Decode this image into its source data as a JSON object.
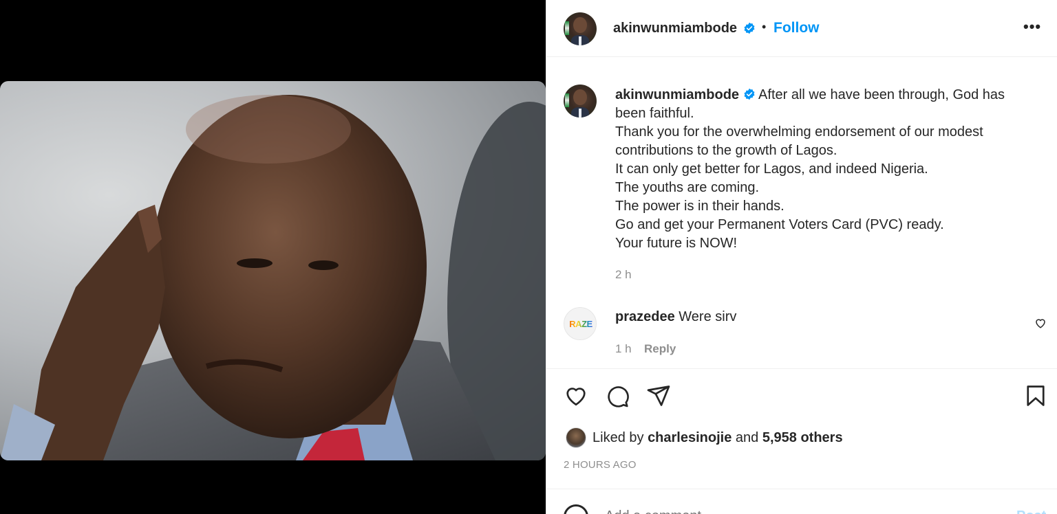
{
  "header": {
    "username": "akinwunmiambode",
    "separator": "•",
    "follow_label": "Follow",
    "more_label": "•••"
  },
  "caption": {
    "username": "akinwunmiambode",
    "first_line": "After all we have been through, God has been faithful.",
    "lines": [
      "Thank you for the overwhelming endorsement of our modest contributions to the growth of Lagos.",
      "It can only get better for Lagos, and indeed Nigeria.",
      "The youths are coming.",
      "The power is in their hands.",
      "Go and get your Permanent Voters Card (PVC) ready.",
      "Your future is NOW!"
    ],
    "time": "2 h"
  },
  "comments": [
    {
      "username": "prazedee",
      "text": "Were sirv",
      "avatar_text": "RAZE",
      "time": "1 h",
      "reply_label": "Reply"
    }
  ],
  "likes": {
    "prefix": "Liked by",
    "liker": "charlesinojie",
    "conjunction": "and",
    "others": "5,958 others"
  },
  "posted_ago": "2 HOURS AGO",
  "add_comment": {
    "placeholder": "Add a comment...",
    "post_label": "Post"
  },
  "colors": {
    "accent": "#0095f6",
    "verified": "#0095f6",
    "muted": "#8e8e8e",
    "text": "#262626"
  },
  "icons": [
    "heart-icon",
    "comment-icon",
    "share-icon",
    "bookmark-icon",
    "verified-icon",
    "more-icon",
    "emoji-icon"
  ]
}
